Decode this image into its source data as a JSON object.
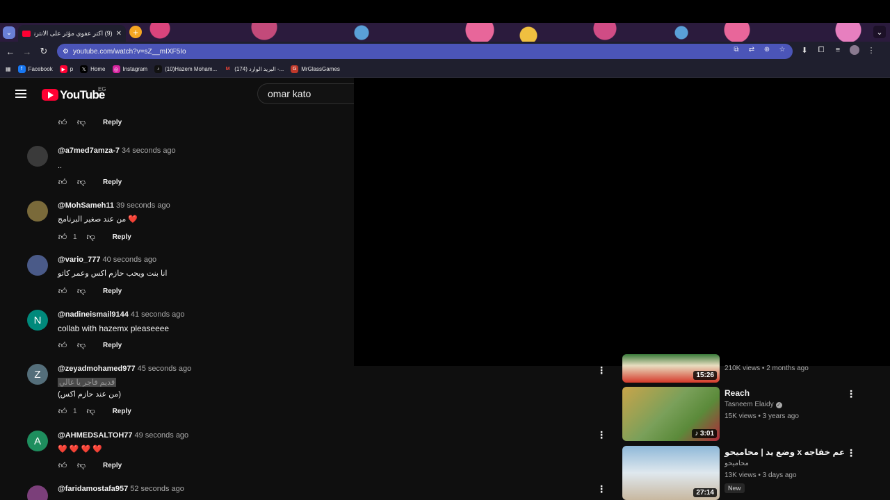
{
  "browser": {
    "tab_title": "(9) اكتر عفوي مؤثر على الانترنت",
    "tab_close": "✕",
    "new_tab": "+",
    "url": "youtube.com/watch?v=sZ__mIXF5Io",
    "bookmarks": [
      {
        "label": "Facebook",
        "color": "#1877f2",
        "glyph": "f"
      },
      {
        "label": "p",
        "color": "#ff0033",
        "glyph": "▶"
      },
      {
        "label": "Home",
        "color": "#000000",
        "glyph": "𝕏"
      },
      {
        "label": "Instagram",
        "color": "#d6249f",
        "glyph": "◎"
      },
      {
        "label": "(10)Hazem Moham...",
        "color": "#111111",
        "glyph": "♪"
      },
      {
        "label": "(174) البريد الوارد -...",
        "color": "#ea4335",
        "glyph": "M"
      },
      {
        "label": "MrGlassGames",
        "color": "#c0392b",
        "glyph": "G"
      }
    ]
  },
  "youtube": {
    "wordmark": "YouTube",
    "region": "EG",
    "search_query": "omar kato"
  },
  "comments": [
    {
      "author": "",
      "time": "",
      "text": "",
      "likes": "",
      "reply": "Reply"
    },
    {
      "author": "@a7med7amza-7",
      "time": "34 seconds ago",
      "text": "..",
      "likes": "",
      "reply": "Reply"
    },
    {
      "author": "@MohSameh11",
      "time": "39 seconds ago",
      "text": "من عند صغير البرنامج ❤️",
      "likes": "1",
      "reply": "Reply"
    },
    {
      "author": "@vario_777",
      "time": "40 seconds ago",
      "text": "انا بنت ويحب حازم اكس وعمر كاتو",
      "likes": "",
      "reply": "Reply"
    },
    {
      "author": "@nadineismail9144",
      "time": "41 seconds ago",
      "text": "collab with hazemx pleaseeee",
      "likes": "",
      "reply": "Reply",
      "avatar_letter": "N",
      "avatar_color": "#00897b"
    },
    {
      "author": "@zeyadmohamed977",
      "time": "45 seconds ago",
      "text": "قديم فاجر يا غالي",
      "text2": "(من عند حازم اكس)",
      "likes": "1",
      "reply": "Reply",
      "avatar_letter": "Z",
      "avatar_color": "#546e7a"
    },
    {
      "author": "@AHMEDSALTOH77",
      "time": "49 seconds ago",
      "text": "❤️ ❤️ ❤️ ❤️",
      "likes": "",
      "reply": "Reply",
      "avatar_letter": "A",
      "avatar_color": "#1e8e5e"
    },
    {
      "author": "@faridamostafa957",
      "time": "52 seconds ago",
      "text": "",
      "likes": "",
      "reply": ""
    }
  ],
  "recommendations": [
    {
      "title": "",
      "channel": "",
      "meta": "210K views • 2 months ago",
      "duration": "15:26",
      "badge": ""
    },
    {
      "title": "Reach",
      "channel": "Tasneem Elaidy",
      "meta": "15K views • 3 years ago",
      "duration": "3:01",
      "badge": ""
    },
    {
      "title": "وضع يد | محاميحو x عم خفاجه",
      "channel": "محاميحو",
      "meta": "13K views • 3 days ago",
      "duration": "27:14",
      "badge": "New"
    }
  ],
  "icons": {
    "like": "thumb-up-icon",
    "dislike": "thumb-down-icon",
    "kebab": "more-vert-icon"
  },
  "colors": {
    "youtube_red": "#ff0033",
    "omnibox": "#4b55b8",
    "background": "#0f0f0f"
  }
}
